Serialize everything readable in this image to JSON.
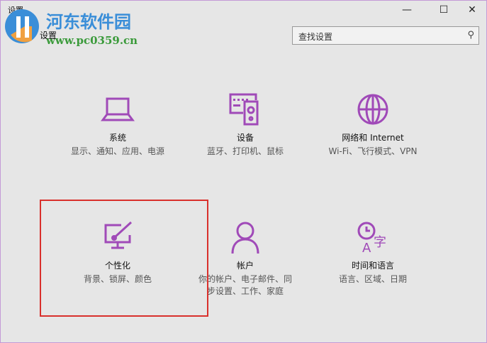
{
  "window": {
    "title": "设置",
    "heading": "设置",
    "minimize": "—",
    "maximize": "☐",
    "close": "✕"
  },
  "watermark": {
    "name": "河东软件园",
    "url": "www.pc0359.cn"
  },
  "search": {
    "placeholder": "查找设置",
    "icon": "search-icon"
  },
  "accent": "#a04ab8",
  "tiles": [
    {
      "name": "系统",
      "desc": "显示、通知、应用、电源",
      "icon": "laptop-icon"
    },
    {
      "name": "设备",
      "desc": "蓝牙、打印机、鼠标",
      "icon": "devices-icon"
    },
    {
      "name": "网络和 Internet",
      "desc": "Wi-Fi、飞行模式、VPN",
      "icon": "globe-icon"
    },
    {
      "name": "个性化",
      "desc": "背景、锁屏、颜色",
      "icon": "personalization-icon"
    },
    {
      "name": "帐户",
      "desc": "你的帐户、电子邮件、同步设置、工作、家庭",
      "icon": "person-icon"
    },
    {
      "name": "时间和语言",
      "desc": "语言、区域、日期",
      "icon": "time-language-icon"
    }
  ]
}
